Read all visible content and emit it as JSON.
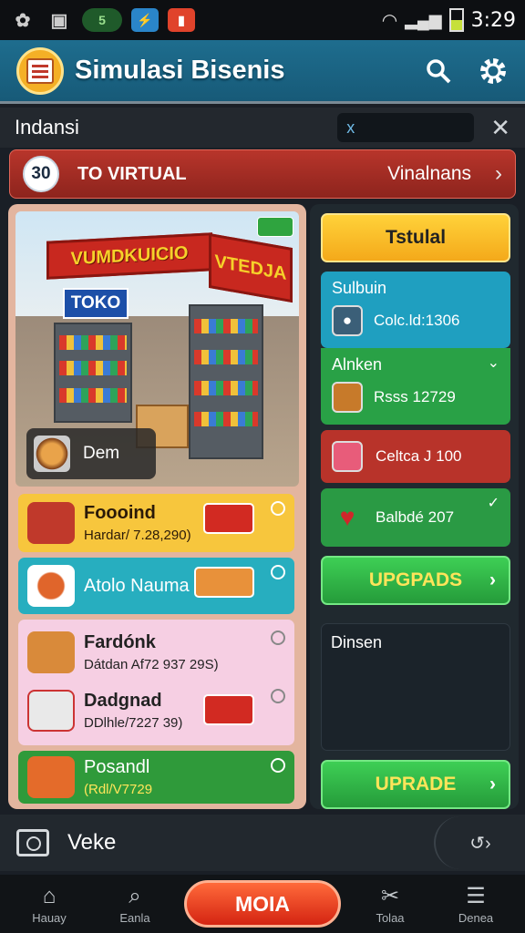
{
  "status": {
    "num": "5",
    "time": "3:29"
  },
  "app": {
    "title": "Simulasi Bisenis"
  },
  "search": {
    "label": "Indansi",
    "placeholder": "",
    "value": "x"
  },
  "banner": {
    "level": "30",
    "left": "TO VIRTUAL",
    "right": "Vinalnans"
  },
  "scene": {
    "sign_main": "VUMDKUICIO",
    "sign_side": "VTEDJA",
    "toko": "TOKO",
    "dem": "Dem"
  },
  "items": [
    {
      "title": "Foooind",
      "sub": "Hardar/ 7.28,290)"
    },
    {
      "title": "Atolo Nauma",
      "sub": ""
    },
    {
      "title": "Fardónk",
      "sub": "Dátdan Af72 937 29S)"
    },
    {
      "title": "Dadgnad",
      "sub": "DDlhle/7227 39)"
    },
    {
      "title": "Posandl",
      "sub": "(Rdl/V7729"
    }
  ],
  "right": {
    "top_button": "Tstulal",
    "card1": {
      "head": "Sulbuin",
      "value": "Colc.ld:1306"
    },
    "card2": {
      "head": "Alnken",
      "value": "Rsss 12729"
    },
    "card3": {
      "value": "Celtca J 100"
    },
    "card4": {
      "value": "Balbdé 207"
    },
    "upgrade1": "UPGPADS",
    "dark": "Dinsen",
    "upgrade2": "UPRADE"
  },
  "bottom": {
    "label": "Veke",
    "next": "↺›"
  },
  "nav": {
    "home": "Hauay",
    "mid_left": "Eanla",
    "main": "MOIA",
    "mid_right": "Tolaa",
    "right": "Denea"
  }
}
